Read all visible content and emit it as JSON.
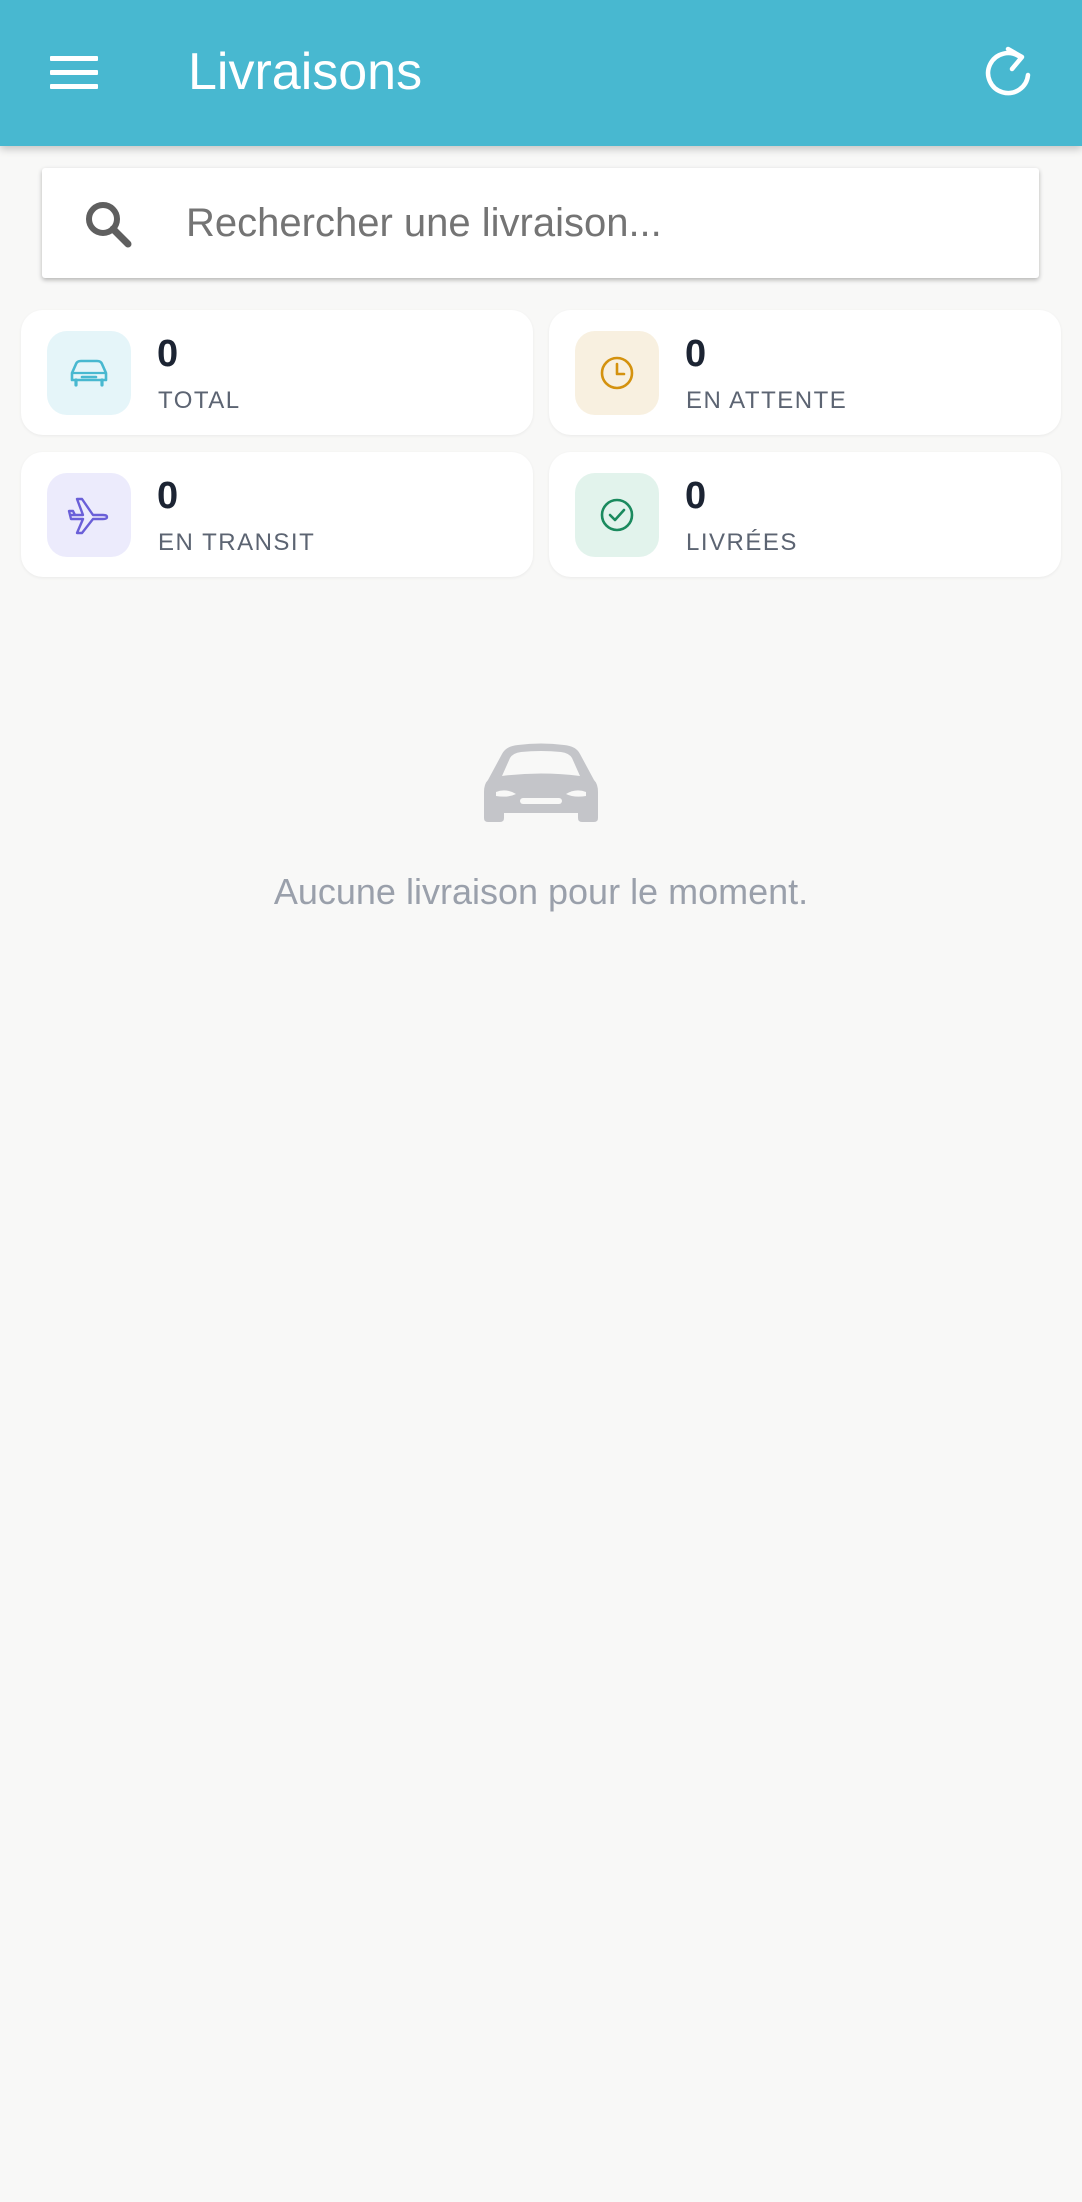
{
  "header": {
    "title": "Livraisons",
    "menu_icon": "menu-icon",
    "refresh_icon": "refresh-icon",
    "background": "#48b8d0"
  },
  "search": {
    "placeholder": "Rechercher une livraison...",
    "value": "",
    "icon": "search-icon"
  },
  "stats": [
    {
      "count": "0",
      "label": "TOTAL",
      "icon": "car-icon",
      "icon_color": "#48b8d0",
      "badge_color": "#e5f5f9"
    },
    {
      "count": "0",
      "label": "EN ATTENTE",
      "icon": "clock-icon",
      "icon_color": "#d4920e",
      "badge_color": "#f8f0e0"
    },
    {
      "count": "0",
      "label": "EN TRANSIT",
      "icon": "airplane-icon",
      "icon_color": "#6a5fd8",
      "badge_color": "#ecebfc"
    },
    {
      "count": "0",
      "label": "LIVRÉES",
      "icon": "check-circle-icon",
      "icon_color": "#1b8a5e",
      "badge_color": "#e2f3ec"
    }
  ],
  "empty_state": {
    "icon": "car-icon",
    "message": "Aucune livraison pour le moment."
  }
}
